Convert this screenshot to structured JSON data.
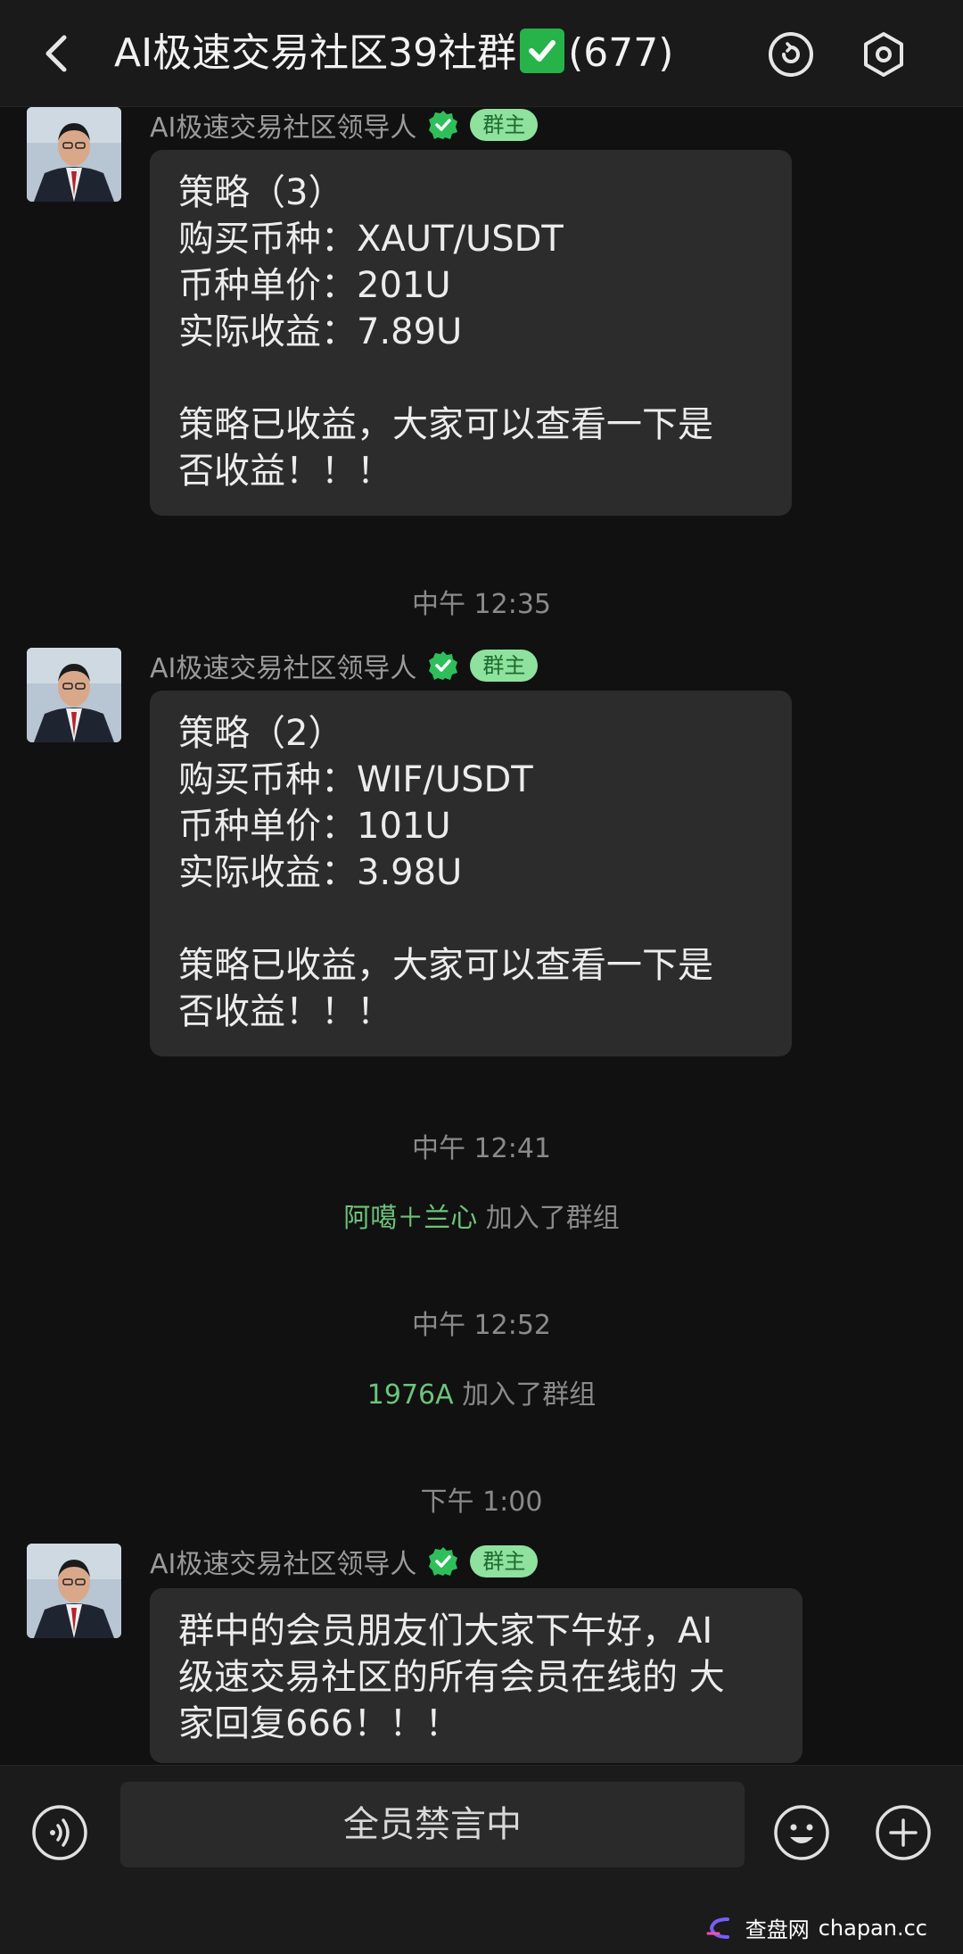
{
  "header": {
    "title_prefix": "AI极速交易社区39社群",
    "title_suffix": "(677)"
  },
  "messages": [
    {
      "sender": "AI极速交易社区领导人",
      "badge": "群主",
      "text": "策略（3）\n购买币种：XAUT/USDT\n币种单价：201U\n实际收益：7.89U\n\n策略已收益，大家可以查看一下是\n否收益！！！"
    },
    {
      "sender": "AI极速交易社区领导人",
      "badge": "群主",
      "text": "策略（2）\n购买币种：WIF/USDT\n币种单价：101U\n实际收益：3.98U\n\n策略已收益，大家可以查看一下是\n否收益！！！"
    },
    {
      "sender": "AI极速交易社区领导人",
      "badge": "群主",
      "text": "群中的会员朋友们大家下午好，AI\n级速交易社区的所有会员在线的 大\n家回复666！！！"
    }
  ],
  "timestamps": [
    "中午 12:35",
    "中午 12:41",
    "中午 12:52",
    "下午 1:00"
  ],
  "system_events": [
    {
      "who": "阿噶＋兰心",
      "action": "加入了群组"
    },
    {
      "who": "1976A",
      "action": "加入了群组"
    }
  ],
  "input_bar": {
    "muted_text": "全员禁言中"
  },
  "watermark": {
    "brand_cn": "查盘网",
    "brand_en": "chapan.cc"
  },
  "colors": {
    "background": "#111111",
    "bubble": "#2c2c2c",
    "accent_green": "#6cc37b",
    "badge_bg": "#8ee29d",
    "verified": "#2fbf5a"
  },
  "icons": [
    "back-icon",
    "refresh-icon",
    "settings-icon",
    "verified-icon",
    "voice-icon",
    "emoji-icon",
    "add-icon"
  ]
}
